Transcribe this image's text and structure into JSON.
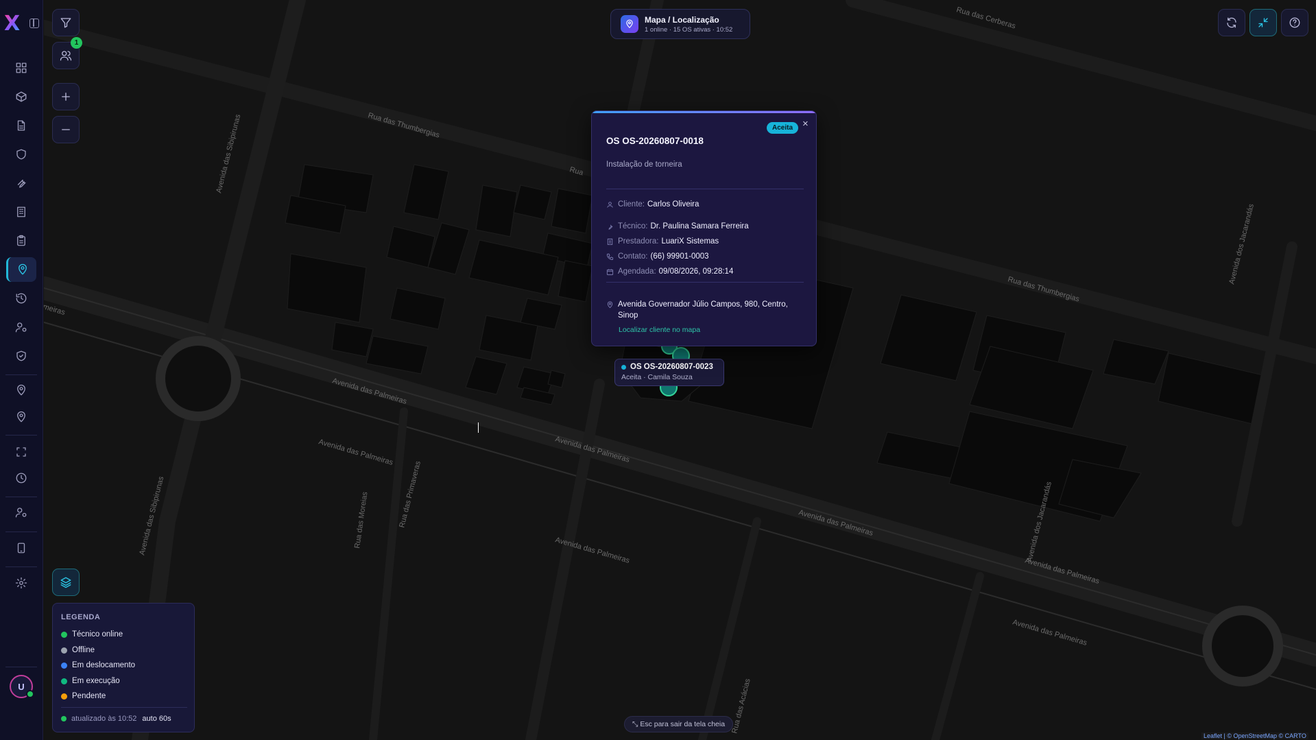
{
  "header": {
    "title": "Mapa / Localização",
    "subtitle": "1 online · 15 OS ativas · 10:52"
  },
  "sidebar": {
    "items": [
      {
        "icon": "dashboard-icon"
      },
      {
        "icon": "box-icon"
      },
      {
        "icon": "file-text-icon"
      },
      {
        "icon": "shield-icon"
      },
      {
        "icon": "wrench-icon"
      },
      {
        "icon": "building-icon"
      },
      {
        "icon": "clipboard-icon"
      },
      {
        "icon": "map-pin-icon",
        "active": true
      },
      {
        "icon": "history-icon"
      },
      {
        "icon": "user-cog-icon"
      },
      {
        "icon": "shield-check-icon"
      },
      {
        "icon": "location-icon"
      },
      {
        "icon": "location-alt-icon"
      },
      {
        "icon": "expand-icon"
      },
      {
        "icon": "clock-icon"
      },
      {
        "icon": "user-settings-icon"
      },
      {
        "icon": "tablet-icon"
      },
      {
        "icon": "settings-icon"
      }
    ],
    "avatar_initial": "U"
  },
  "map_controls": {
    "technicians_badge": "1"
  },
  "popup": {
    "status": "Aceita",
    "title": "OS OS-20260807-0018",
    "description": "Instalação de torneira",
    "client_label": "Cliente:",
    "client": "Carlos Oliveira",
    "technician_label": "Técnico:",
    "technician": "Dr. Paulina Samara Ferreira",
    "provider_label": "Prestadora:",
    "provider": "LuariX Sistemas",
    "contact_label": "Contato:",
    "contact": "(66) 99901-0003",
    "scheduled_label": "Agendada:",
    "scheduled": "09/08/2026, 09:28:14",
    "address": "Avenida Governador Júlio Campos, 980, Centro, Sinop",
    "locate_link": "Localizar cliente no mapa",
    "close": "×"
  },
  "marker_tooltip": {
    "title": "OS OS-20260807-0023",
    "subtitle": "Aceita · Camila Souza"
  },
  "legend": {
    "title": "LEGENDA",
    "items": [
      {
        "label": "Técnico online",
        "color": "#22c55e"
      },
      {
        "label": "Offline",
        "color": "#9ca3af"
      },
      {
        "label": "Em deslocamento",
        "color": "#3b82f6"
      },
      {
        "label": "Em execução",
        "color": "#10b981"
      },
      {
        "label": "Pendente",
        "color": "#f59e0b"
      }
    ],
    "updated": "atualizado às 10:52",
    "auto": "auto 60s"
  },
  "esc_hint": "Esc para sair da tela cheia",
  "attribution": "Leaflet | © OpenStreetMap © CARTO",
  "street_labels": {
    "thumbergias": "Rua das Thumbergias",
    "cerberas": "Rua das Cerberas",
    "sibipirunas": "Avenida das Sibipirunas",
    "palmeiras": "Avenida das Palmeiras",
    "jacarandas": "Avenida dos Jacarandás",
    "moreias": "Rua das Moreias",
    "primaveras": "Rua das Primaveras",
    "acacias": "Rua das Acácias",
    "meiras": "meiras",
    "rua": "Rua"
  }
}
